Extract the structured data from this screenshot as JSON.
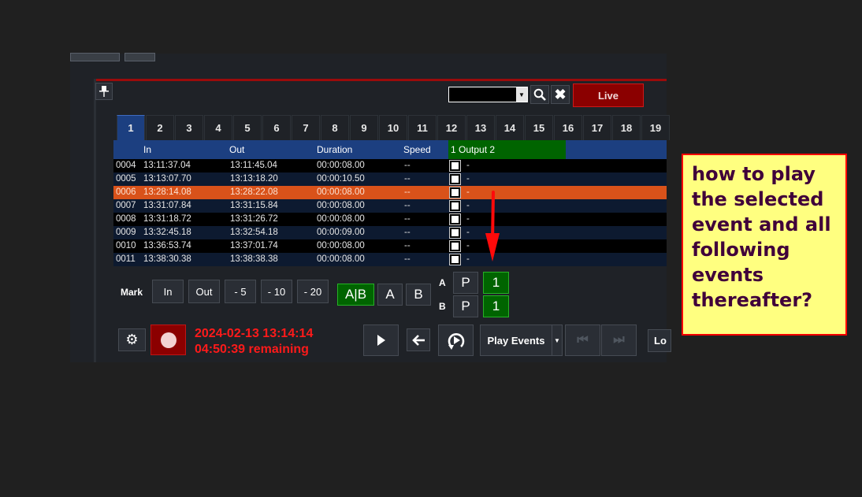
{
  "toolbar": {
    "search_combo_value": "",
    "live_label": "Live"
  },
  "tabs": [
    "1",
    "2",
    "3",
    "4",
    "5",
    "6",
    "7",
    "8",
    "9",
    "10",
    "11",
    "12",
    "13",
    "14",
    "15",
    "16",
    "17",
    "18",
    "19"
  ],
  "active_tab": "1",
  "grid": {
    "columns": {
      "in": "In",
      "out": "Out",
      "duration": "Duration",
      "speed": "Speed",
      "output": "1 Output 2"
    },
    "rows": [
      {
        "id": "0004",
        "in": "13:11:37.04",
        "out": "13:11:45.04",
        "duration": "00:00:08.00",
        "speed": "--",
        "output": "-",
        "selected": false
      },
      {
        "id": "0005",
        "in": "13:13:07.70",
        "out": "13:13:18.20",
        "duration": "00:00:10.50",
        "speed": "--",
        "output": "-",
        "selected": false
      },
      {
        "id": "0006",
        "in": "13:28:14.08",
        "out": "13:28:22.08",
        "duration": "00:00:08.00",
        "speed": "--",
        "output": "-",
        "selected": true
      },
      {
        "id": "0007",
        "in": "13:31:07.84",
        "out": "13:31:15.84",
        "duration": "00:00:08.00",
        "speed": "--",
        "output": "-",
        "selected": false
      },
      {
        "id": "0008",
        "in": "13:31:18.72",
        "out": "13:31:26.72",
        "duration": "00:00:08.00",
        "speed": "--",
        "output": "-",
        "selected": false
      },
      {
        "id": "0009",
        "in": "13:32:45.18",
        "out": "13:32:54.18",
        "duration": "00:00:09.00",
        "speed": "--",
        "output": "-",
        "selected": false
      },
      {
        "id": "0010",
        "in": "13:36:53.74",
        "out": "13:37:01.74",
        "duration": "00:00:08.00",
        "speed": "--",
        "output": "-",
        "selected": false
      },
      {
        "id": "0011",
        "in": "13:38:30.38",
        "out": "13:38:38.38",
        "duration": "00:00:08.00",
        "speed": "--",
        "output": "-",
        "selected": false
      }
    ]
  },
  "mark": {
    "label": "Mark",
    "in": "In",
    "out": "Out",
    "minus5": "- 5",
    "minus10": "- 10",
    "minus20": "- 20",
    "ab": "A|B",
    "a": "A",
    "b": "B"
  },
  "channels": {
    "a_label": "A",
    "b_label": "B",
    "a_p": "P",
    "b_p": "P",
    "a_num": "1",
    "b_num": "1"
  },
  "status": {
    "datetime": "2024-02-13 13:14:14",
    "remaining": "04:50:39 remaining"
  },
  "transport": {
    "play_events_label": "Play Events",
    "lock_label": "Lo"
  },
  "colors": {
    "accent_blue": "#1c3f80",
    "selection_orange": "#d9521a",
    "output_green": "#006400",
    "live_red": "#8b0000",
    "note_yellow": "#ffff80"
  },
  "annotation": {
    "text": "how to play the selected event and all following events thereafter?"
  }
}
